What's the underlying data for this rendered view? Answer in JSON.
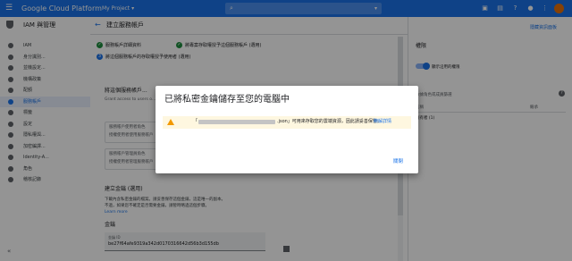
{
  "topbar": {
    "brand": "Google Cloud Platform",
    "project": "My Project ▾",
    "colors": {
      "bar": "#1a73e8"
    }
  },
  "sidebar": {
    "title": "IAM 與管理",
    "items": [
      {
        "label": "IAM",
        "icon": "person-add-icon"
      },
      {
        "label": "身分識別...",
        "icon": "identity-icon"
      },
      {
        "label": "並機設定...",
        "icon": "settings-icon"
      },
      {
        "label": "機構政策",
        "icon": "policy-icon"
      },
      {
        "label": "配額",
        "icon": "quota-icon"
      },
      {
        "label": "服務帳戶",
        "icon": "service-account-icon",
        "active": true
      },
      {
        "label": "標籤",
        "icon": "label-icon"
      },
      {
        "label": "設定",
        "icon": "gear-icon"
      },
      {
        "label": "隱私權與...",
        "icon": "privacy-icon"
      },
      {
        "label": "加密編譯...",
        "icon": "crypto-icon"
      },
      {
        "label": "Identity-A...",
        "icon": "identity-aware-icon"
      },
      {
        "label": "角色",
        "icon": "role-icon"
      },
      {
        "label": "稽核記錄",
        "icon": "audit-log-icon"
      }
    ]
  },
  "main": {
    "header": "建立服務帳戶",
    "steps": [
      {
        "num": "✓",
        "label": "服務帳戶詳細資料"
      },
      {
        "num": "✓",
        "label": "將專案存取權授予這個服務帳戶 (選用)"
      },
      {
        "num": "3",
        "label": "將這個服務帳戶的存取權授予使用者 (選用)"
      }
    ],
    "section_title": "將這個服務帳戶...",
    "section_desc": "Grant access to users o...",
    "role1_title": "服務帳戶使用者角色",
    "role1_desc": "授權使用者使用服務帳戶",
    "role2_title": "服務帳戶管理員角色",
    "role2_desc": "授權使用者管理服務帳戶",
    "key_title": "建立金鑰 (選用)",
    "key_desc1": "下載內含私密金鑰的檔案。請妥善保存這個金鑰，這是唯一的副本。",
    "key_desc2": "不過，如果您不確定是否需要金鑰，請暫時略過這個步驟。",
    "learn_more": "Learn more",
    "key_section": "金鑰",
    "key_id_label": "金鑰 ID",
    "key_id_value": "be27f64afe9319a342d0170316642d56b3d155db"
  },
  "right": {
    "title": "權限",
    "learn_more": "隱藏資訊面板",
    "toggle_label": "顯示沿用的權限",
    "filter": "依據角色或成員篩選",
    "col1": "名稱",
    "col2": "繼承",
    "row1": "擁有者 (1)"
  },
  "dialog": {
    "title": "已將私密金鑰儲存至您的電腦中",
    "bracket": "「",
    "notice": ".json」可用來存取您的雲端資源，因此請妥善保管。",
    "link": "瞭解詳情",
    "close": "關閉"
  }
}
